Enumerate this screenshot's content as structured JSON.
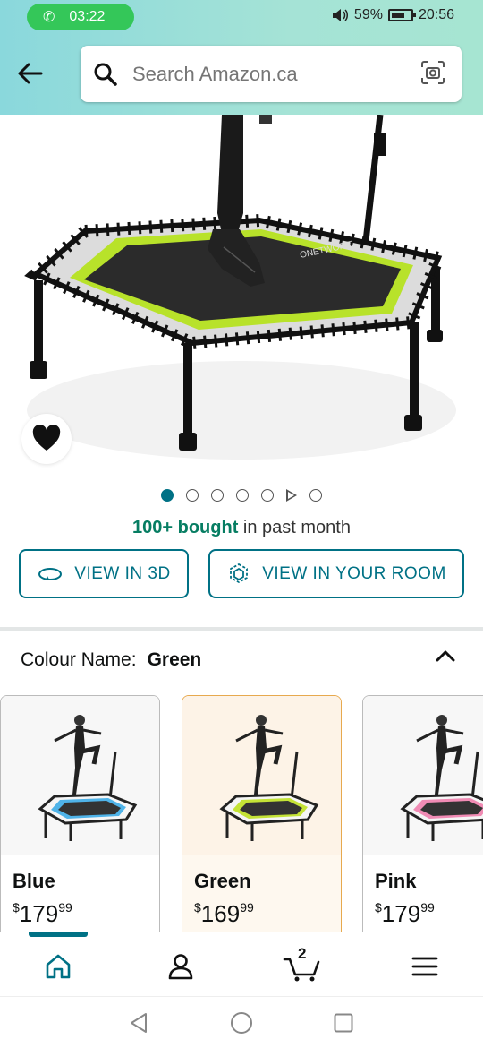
{
  "status_bar": {
    "call_time": "03:22",
    "battery": "59%",
    "clock": "20:56"
  },
  "search": {
    "placeholder": "Search Amazon.ca"
  },
  "product": {
    "carousel_dot_count": 7,
    "active_dot": 1,
    "brand_mark": "ONETWOFIT",
    "bought_highlight": "100+ bought",
    "bought_rest": " in past month",
    "view_3d_label": "VIEW IN 3D",
    "view_room_label": "VIEW IN YOUR ROOM"
  },
  "colour": {
    "label": "Colour Name:",
    "value": "Green"
  },
  "swatches": [
    {
      "name": "Blue",
      "currency": "$",
      "price_whole": "179",
      "price_cents": "99",
      "accent": "#4fb3e8"
    },
    {
      "name": "Green",
      "currency": "$",
      "price_whole": "169",
      "price_cents": "99",
      "accent": "#c4e336"
    },
    {
      "name": "Pink",
      "currency": "$",
      "price_whole": "179",
      "price_cents": "99",
      "accent": "#f08bb4"
    }
  ],
  "bottom_nav": {
    "cart_count": "2",
    "items": [
      "home-icon",
      "account-icon",
      "cart-icon",
      "menu-icon"
    ]
  },
  "colors": {
    "teal": "#007185",
    "bought_green": "#067d62",
    "selected_border": "#e7a94e",
    "trampoline_lime": "#b8e22a"
  }
}
